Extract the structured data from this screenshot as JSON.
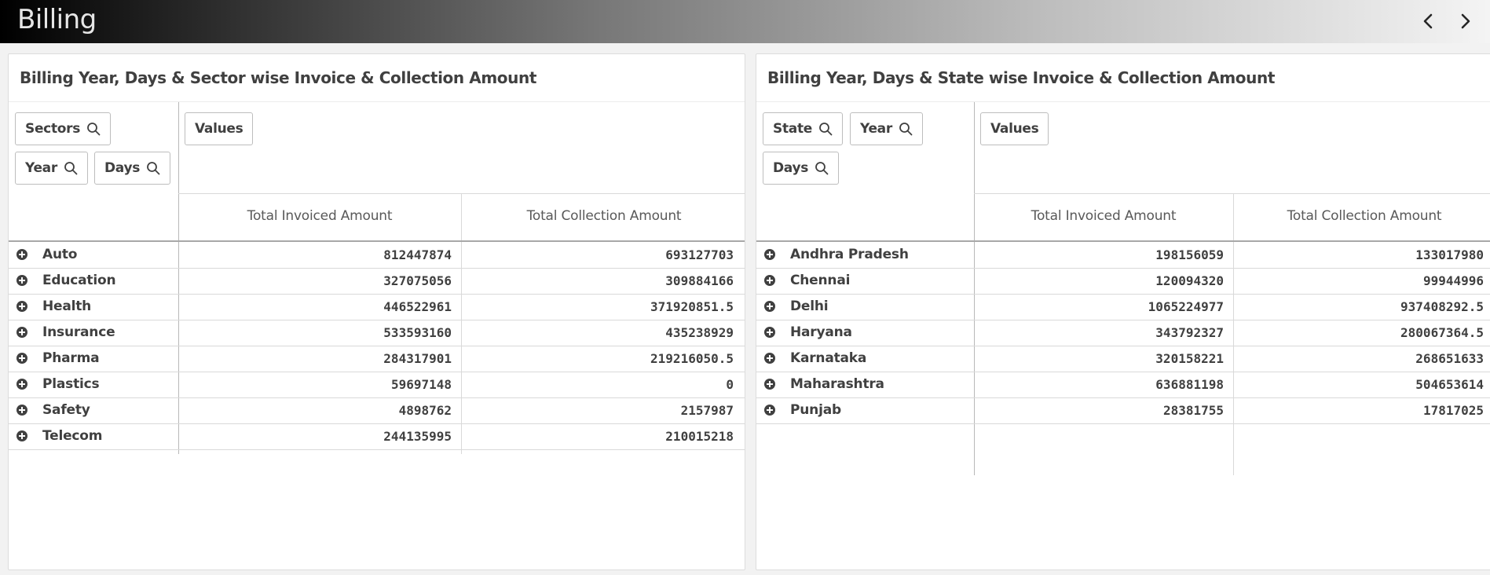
{
  "app": {
    "title": "Billing",
    "prev_icon": "chevron-left-icon",
    "next_icon": "chevron-right-icon"
  },
  "left_panel": {
    "title": "Billing Year, Days & Sector wise Invoice & Collection Amount",
    "chips": {
      "sectors": "Sectors",
      "year": "Year",
      "days": "Days",
      "values": "Values"
    },
    "columns": [
      "Total Invoiced Amount",
      "Total Collection Amount"
    ],
    "rows": [
      {
        "label": "Auto",
        "invoiced": "812447874",
        "collection": "693127703"
      },
      {
        "label": "Education",
        "invoiced": "327075056",
        "collection": "309884166"
      },
      {
        "label": "Health",
        "invoiced": "446522961",
        "collection": "371920851.5"
      },
      {
        "label": "Insurance",
        "invoiced": "533593160",
        "collection": "435238929"
      },
      {
        "label": "Pharma",
        "invoiced": "284317901",
        "collection": "219216050.5"
      },
      {
        "label": "Plastics",
        "invoiced": "59697148",
        "collection": "0"
      },
      {
        "label": "Safety",
        "invoiced": "4898762",
        "collection": "2157987"
      },
      {
        "label": "Telecom",
        "invoiced": "244135995",
        "collection": "210015218"
      }
    ]
  },
  "right_panel": {
    "title": "Billing Year, Days & State wise Invoice & Collection Amount",
    "chips": {
      "state": "State",
      "year": "Year",
      "days": "Days",
      "values": "Values"
    },
    "columns": [
      "Total Invoiced Amount",
      "Total Collection Amount"
    ],
    "rows": [
      {
        "label": "Andhra Pradesh",
        "invoiced": "198156059",
        "collection": "133017980"
      },
      {
        "label": "Chennai",
        "invoiced": "120094320",
        "collection": "99944996"
      },
      {
        "label": "Delhi",
        "invoiced": "1065224977",
        "collection": "937408292.5"
      },
      {
        "label": "Haryana",
        "invoiced": "343792327",
        "collection": "280067364.5"
      },
      {
        "label": "Karnataka",
        "invoiced": "320158221",
        "collection": "268651633"
      },
      {
        "label": "Maharashtra",
        "invoiced": "636881198",
        "collection": "504653614"
      },
      {
        "label": "Punjab",
        "invoiced": "28381755",
        "collection": "17817025"
      }
    ]
  },
  "colors": {
    "text": "#404040",
    "header_text": "#595959",
    "panel_bg": "#ffffff",
    "page_bg": "#f2f2f2"
  }
}
